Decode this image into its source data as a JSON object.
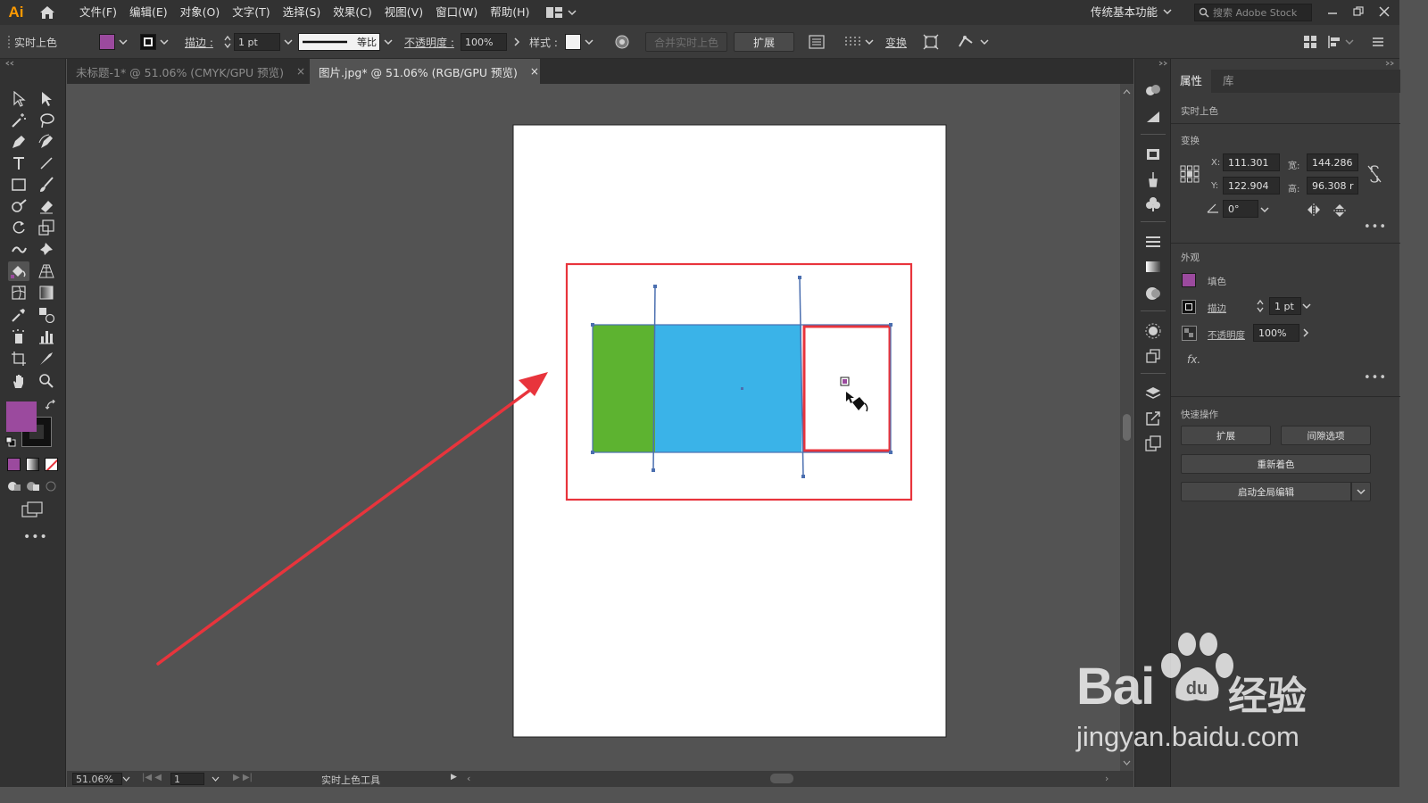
{
  "app": {
    "logo": "Ai",
    "menu": [
      "文件(F)",
      "编辑(E)",
      "对象(O)",
      "文字(T)",
      "选择(S)",
      "效果(C)",
      "视图(V)",
      "窗口(W)",
      "帮助(H)"
    ],
    "workspace": "传统基本功能",
    "stock_search_placeholder": "搜索 Adobe Stock"
  },
  "control_bar": {
    "mode_label": "实时上色",
    "fill_color": "#9b4a9e",
    "stroke_label": "描边 :",
    "stroke_weight": "1 pt",
    "stroke_profile": "等比",
    "opacity_label": "不透明度 :",
    "opacity_value": "100%",
    "style_label": "样式 :",
    "merge_button": "合并实时上色",
    "expand_button": "扩展",
    "transform_label": "变换"
  },
  "tabs": [
    {
      "label": "未标题-1* @ 51.06% (CMYK/GPU 预览)",
      "close": "×"
    },
    {
      "label": "图片.jpg* @ 51.06% (RGB/GPU 预览)",
      "close": "×"
    }
  ],
  "canvas": {
    "colors": {
      "green": "#5db330",
      "blue": "#3ab3e8",
      "red_outline": "#e8343c",
      "arrow": "#e8343c",
      "path": "#4b6fb0"
    }
  },
  "status_bar": {
    "zoom": "51.06%",
    "page": "1",
    "tool_name": "实时上色工具"
  },
  "panel": {
    "tabs": [
      "属性",
      "库"
    ],
    "object_type": "实时上色",
    "transform": {
      "title": "变换",
      "x_label": "X:",
      "x": "111.301",
      "y_label": "Y:",
      "y": "122.904",
      "w_label": "宽:",
      "w": "144.286",
      "h_label": "高:",
      "h": "96.308 r",
      "angle": "0°"
    },
    "appearance": {
      "title": "外观",
      "fill_label": "填色",
      "fill_color": "#9b4a9e",
      "stroke_label": "描边",
      "stroke_weight": "1 pt",
      "opacity_label": "不透明度",
      "opacity": "100%",
      "fx": "fx."
    },
    "quick_actions": {
      "title": "快速操作",
      "expand": "扩展",
      "gap_options": "间隙选项",
      "recolor": "重新着色",
      "global_edit": "启动全局编辑"
    }
  },
  "watermark": {
    "brand": "Bai",
    "brand_cn": "经验",
    "url": "jingyan.baidu.com"
  }
}
